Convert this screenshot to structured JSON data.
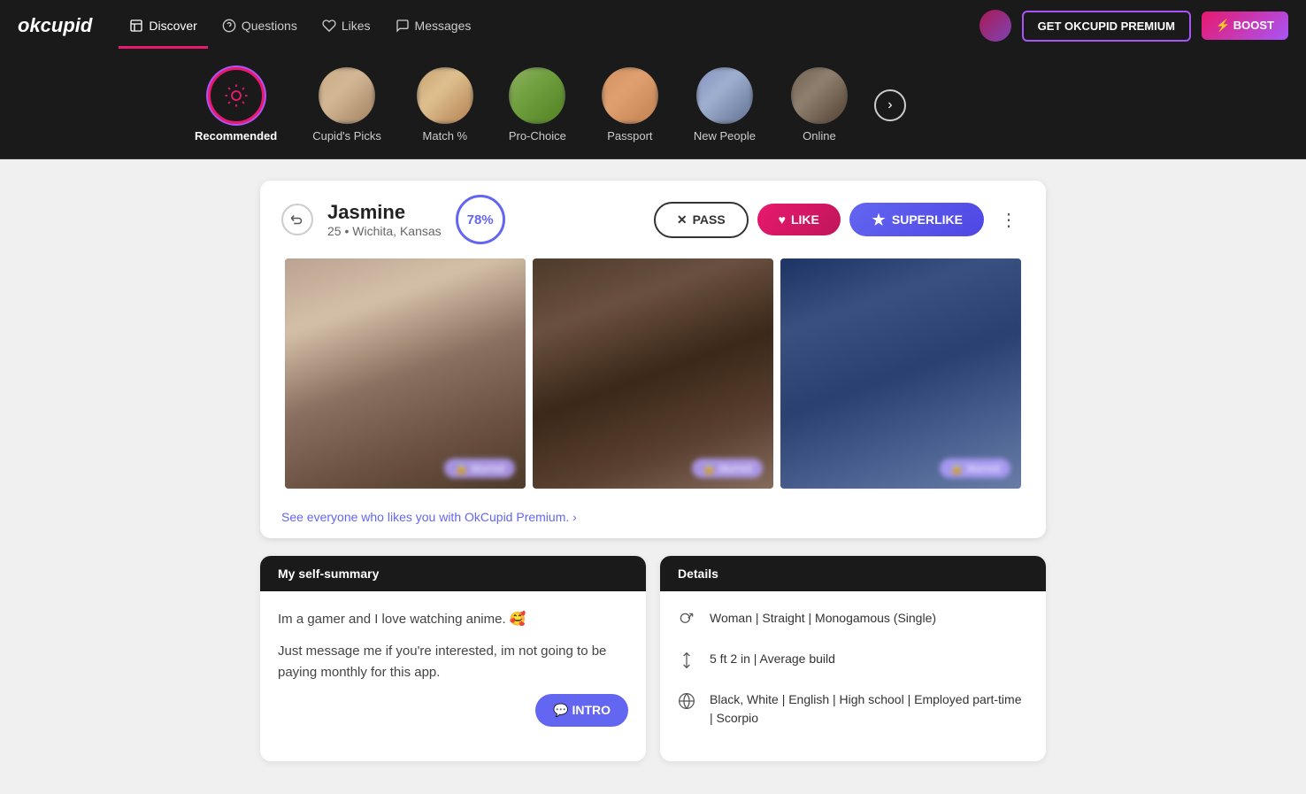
{
  "app": {
    "logo": "okcupid",
    "nav": {
      "items": [
        {
          "label": "Discover",
          "icon": "compass-icon",
          "active": true
        },
        {
          "label": "Questions",
          "icon": "question-icon",
          "active": false
        },
        {
          "label": "Likes",
          "icon": "heart-icon",
          "active": false
        },
        {
          "label": "Messages",
          "icon": "message-icon",
          "active": false
        }
      ],
      "premium_label": "GET OKCUPID PREMIUM",
      "boost_label": "⚡ BOOST"
    }
  },
  "categories": [
    {
      "label": "Recommended",
      "active": true,
      "type": "icon"
    },
    {
      "label": "Cupid's Picks",
      "active": false,
      "type": "photo"
    },
    {
      "label": "Match %",
      "active": false,
      "type": "photo"
    },
    {
      "label": "Pro-Choice",
      "active": false,
      "type": "photo"
    },
    {
      "label": "Passport",
      "active": false,
      "type": "photo"
    },
    {
      "label": "New People",
      "active": false,
      "type": "photo"
    },
    {
      "label": "Online",
      "active": false,
      "type": "photo"
    }
  ],
  "profile": {
    "name": "Jasmine",
    "age": 25,
    "location": "Wichita, Kansas",
    "match_percent": "78%",
    "actions": {
      "pass": "PASS",
      "like": "LIKE",
      "superlike": "SUPERLIKE"
    },
    "premium_prompt": "See everyone who likes you with OkCupid Premium. ›",
    "self_summary": {
      "header": "My self-summary",
      "text1": "Im a gamer and I love watching anime. 🥰",
      "text2": "Just message me if you're interested, im not going to be paying monthly for this app.",
      "intro_label": "💬 INTRO"
    },
    "details": {
      "header": "Details",
      "items": [
        {
          "icon": "gender-icon",
          "text": "Woman | Straight | Monogamous (Single)"
        },
        {
          "icon": "height-icon",
          "text": "5 ft 2 in | Average build"
        },
        {
          "icon": "globe-icon",
          "text": "Black, White | English | High school | Employed part-time | Scorpio"
        }
      ]
    }
  }
}
